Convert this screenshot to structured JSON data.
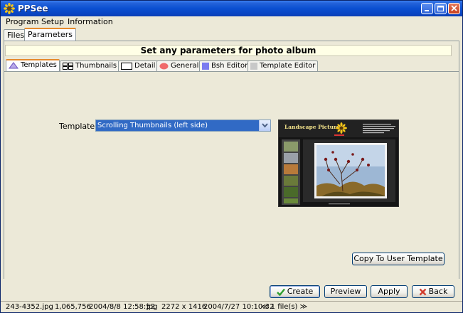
{
  "window": {
    "title": "PPSee"
  },
  "menu": {
    "program": "Program",
    "setup": "Setup",
    "information": "Information"
  },
  "outer_tabs": {
    "files": "Files",
    "parameters": "Parameters"
  },
  "heading": "Set any parameters for photo album",
  "inner_tabs": {
    "templates": "Templates",
    "thumbnails": "Thumbnails",
    "detail": "Detail",
    "general": "General",
    "bsh_editor": "Bsh Editor",
    "template_editor": "Template Editor"
  },
  "template": {
    "label": "Template:",
    "selected": "Scrolling Thumbnails  (left side)"
  },
  "preview_image": {
    "title": "Landscape Pictures"
  },
  "buttons": {
    "copy_to_user_template": "Copy To User Template",
    "create": "Create",
    "preview": "Preview",
    "apply": "Apply",
    "back": "Back"
  },
  "status": {
    "filename": "243-4352.jpg",
    "size": "1,065,756",
    "date": "2004/8/8 12:58:52",
    "type": "jpg",
    "dimensions": "2272 x 1416",
    "date2": "2004/7/27 10:10:32",
    "file_count": "≪ 1 file(s) ≫"
  },
  "colors": {
    "titlebar": "#0A4FD1",
    "selection": "#316AC5",
    "tab_highlight": "#E68B2C"
  }
}
